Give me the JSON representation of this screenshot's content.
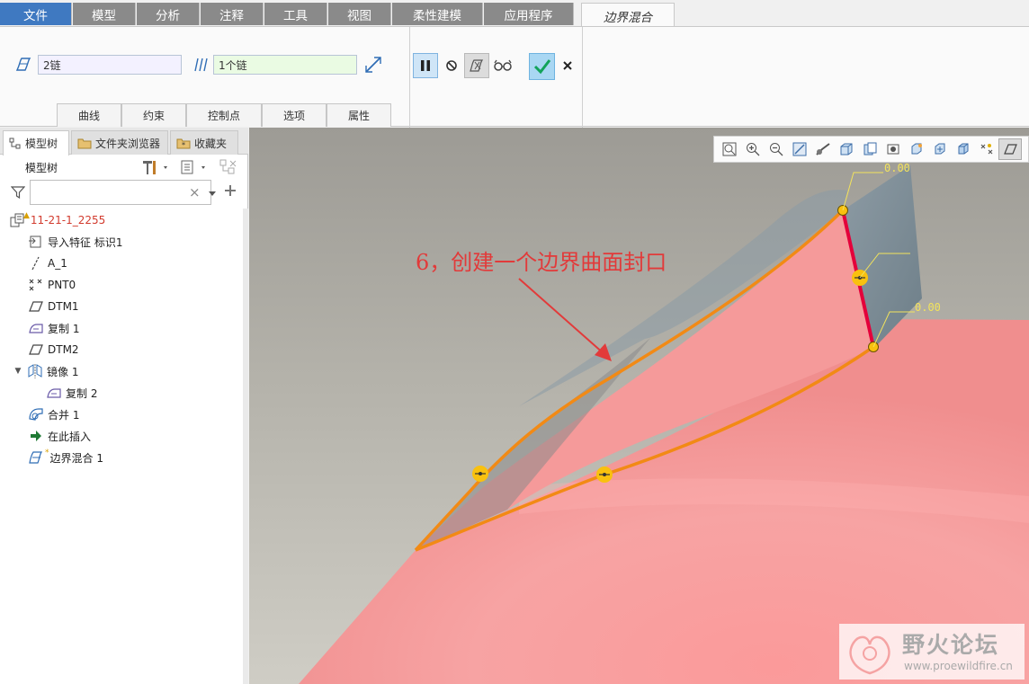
{
  "menu": {
    "tabs": [
      {
        "label": "文件"
      },
      {
        "label": "模型"
      },
      {
        "label": "分析"
      },
      {
        "label": "注释"
      },
      {
        "label": "工具"
      },
      {
        "label": "视图"
      },
      {
        "label": "柔性建模"
      },
      {
        "label": "应用程序"
      },
      {
        "label": "边界混合"
      }
    ]
  },
  "ribbon": {
    "first_direction_value": "2链",
    "second_direction_value": "1个链",
    "subtabs": [
      {
        "label": "曲线"
      },
      {
        "label": "约束"
      },
      {
        "label": "控制点"
      },
      {
        "label": "选项"
      },
      {
        "label": "属性"
      }
    ],
    "colors": {
      "field1_bg": "#f3f1ff",
      "field2_bg": "#eafbe3",
      "confirm_bg": "#a9d7f3",
      "check": "#12a35a"
    }
  },
  "panel": {
    "tabs": [
      {
        "label": "模型树"
      },
      {
        "label": "文件夹浏览器"
      },
      {
        "label": "收藏夹"
      }
    ],
    "tree_title": "模型树",
    "search_placeholder": "",
    "clear_symbol": "×",
    "tree": [
      {
        "label": "11-21-1_2255",
        "icon": "assembly-icon"
      },
      {
        "label": "导入特征 标识1",
        "icon": "import-feature-icon"
      },
      {
        "label": "A_1",
        "icon": "axis-icon"
      },
      {
        "label": "PNT0",
        "icon": "point-icon"
      },
      {
        "label": "DTM1",
        "icon": "datum-plane-icon"
      },
      {
        "label": "DTM2",
        "icon": "datum-plane-icon"
      },
      {
        "label": "复制 1",
        "icon": "copy-surface-icon"
      },
      {
        "label": "镜像 1",
        "icon": "mirror-icon"
      },
      {
        "label": "复制 2",
        "icon": "copy-surface-icon"
      },
      {
        "label": "合并 1",
        "icon": "merge-icon"
      },
      {
        "label": "在此插入",
        "icon": "insert-here-icon"
      },
      {
        "label": "边界混合 1",
        "icon": "boundary-blend-icon"
      }
    ]
  },
  "viewport": {
    "annotation": "6，创建一个边界曲面封口",
    "dim_labels": [
      "0.00",
      "0.00"
    ],
    "colors": {
      "surface": "#f59a9a",
      "cap": "#7d8e97",
      "edge": "#f28a15",
      "active_edge": "#e4003a",
      "handle": "#f9c10f",
      "annotation": "#e23a3a"
    }
  },
  "watermark": {
    "title": "野火论坛",
    "url": "www.proewildfire.cn"
  }
}
